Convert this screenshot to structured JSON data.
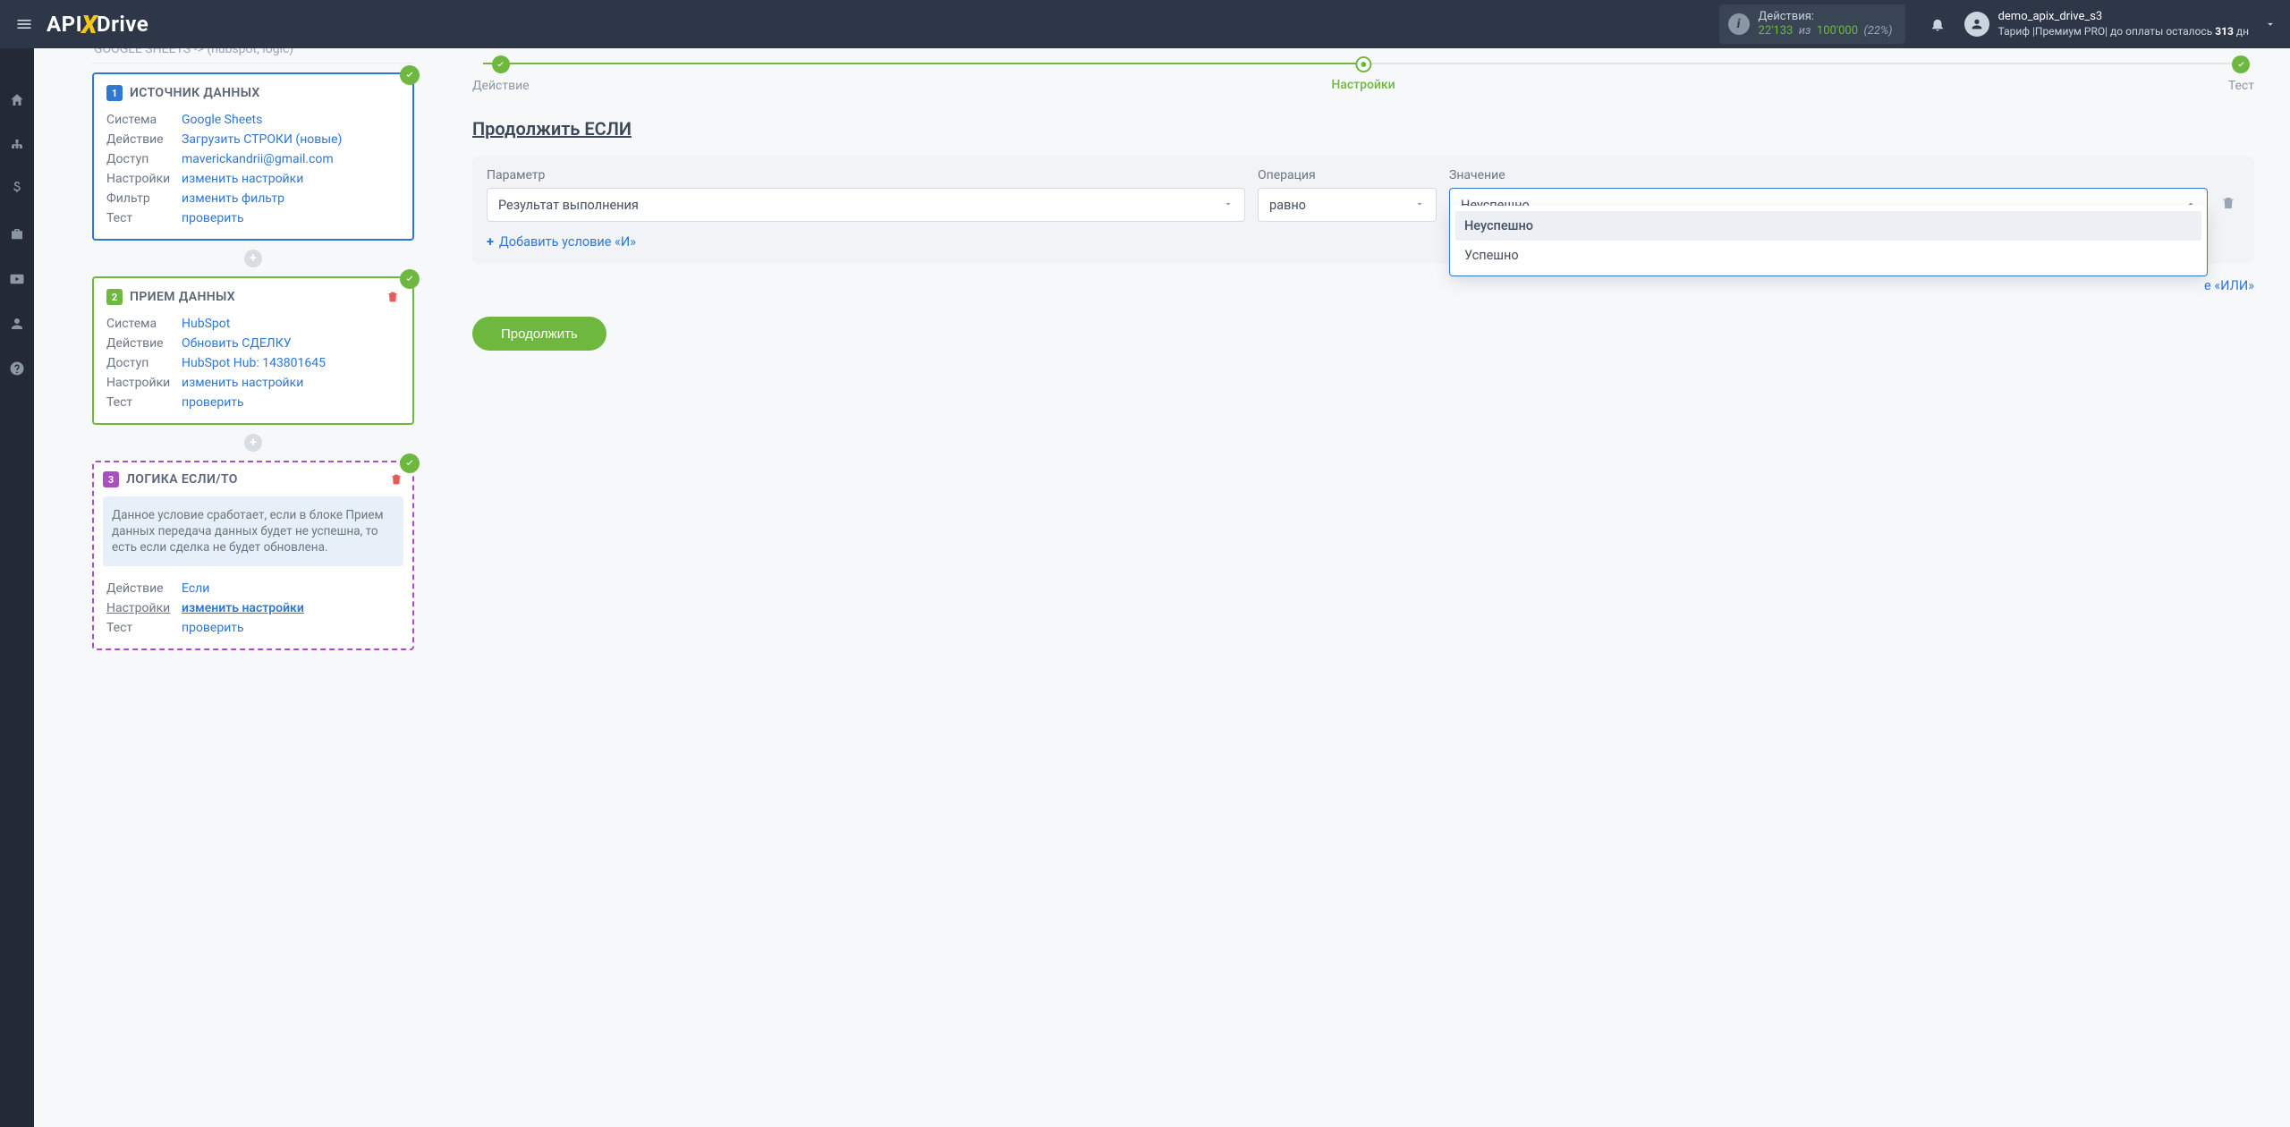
{
  "topbar": {
    "logo": {
      "api": "API",
      "x": "X",
      "drive": "Drive"
    },
    "actions": {
      "title": "Действия:",
      "used": "22'133",
      "of_word": "из",
      "total": "100'000",
      "percent": "(22%)"
    },
    "user": {
      "name": "demo_apix_drive_s3",
      "tariff_prefix": "Тариф |Премиум PRO| до оплаты осталось ",
      "days": "313",
      "days_suffix": " дн"
    }
  },
  "breadcrumb": "GOOGLE SHEETS -> (hubspot, logic)",
  "card1": {
    "title": "ИСТОЧНИК ДАННЫХ",
    "rows": [
      {
        "k": "Система",
        "v": "Google Sheets"
      },
      {
        "k": "Действие",
        "v": "Загрузить СТРОКИ (новые)"
      },
      {
        "k": "Доступ",
        "v": "maverickandrii@gmail.com"
      },
      {
        "k": "Настройки",
        "v": "изменить настройки"
      },
      {
        "k": "Фильтр",
        "v": "изменить фильтр"
      },
      {
        "k": "Тест",
        "v": "проверить"
      }
    ]
  },
  "card2": {
    "title": "ПРИЕМ ДАННЫХ",
    "rows": [
      {
        "k": "Система",
        "v": "HubSpot"
      },
      {
        "k": "Действие",
        "v": "Обновить СДЕЛКУ"
      },
      {
        "k": "Доступ",
        "v": "HubSpot Hub: 143801645"
      },
      {
        "k": "Настройки",
        "v": "изменить настройки"
      },
      {
        "k": "Тест",
        "v": "проверить"
      }
    ]
  },
  "card3": {
    "title": "ЛОГИКА ЕСЛИ/ТО",
    "banner": "Данное условие сработает, если в блоке Прием данных передача данных будет не успешна, то есть если сделка не будет обновлена.",
    "rows": [
      {
        "k": "Действие",
        "v": "Если",
        "link_plain": true
      },
      {
        "k": "Настройки",
        "v": "изменить настройки",
        "underline": true
      },
      {
        "k": "Тест",
        "v": "проверить"
      }
    ]
  },
  "steps": {
    "s1": "Действие",
    "s2": "Настройки",
    "s3": "Тест"
  },
  "section_title": "Продолжить ЕСЛИ",
  "filter": {
    "param_label": "Параметр",
    "param_value": "Результат выполнения",
    "op_label": "Операция",
    "op_value": "равно",
    "val_label": "Значение",
    "val_value": "Неуспешно",
    "options": [
      {
        "label": "Неуспешно",
        "selected": true
      },
      {
        "label": "Успешно",
        "selected": false
      }
    ],
    "add_and": "Добавить условие «И»",
    "add_or": "е «ИЛИ»"
  },
  "continue": "Продолжить",
  "plus": "+"
}
